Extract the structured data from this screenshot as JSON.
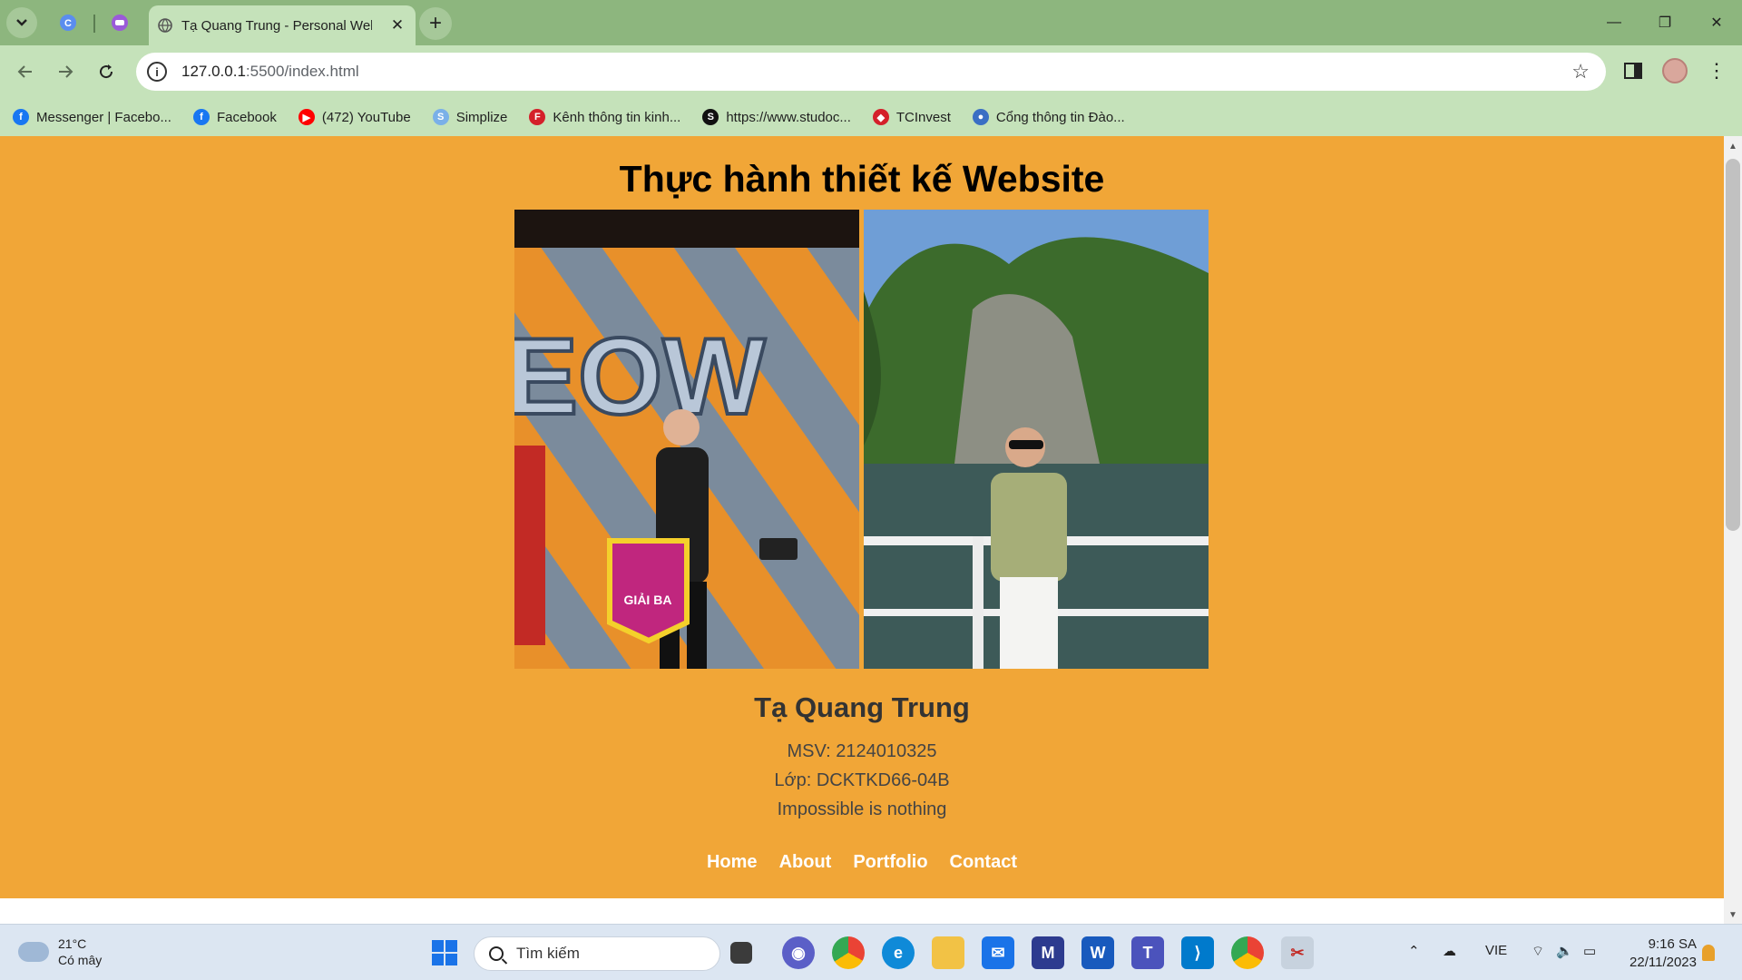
{
  "browser": {
    "tab": {
      "title": "Tạ Quang Trung - Personal Website",
      "close": "✕"
    },
    "new_tab": "+",
    "window": {
      "minimize": "—",
      "maximize": "❐",
      "close": "✕"
    },
    "address": {
      "host": "127.0.0.1",
      "rest": ":5500/index.html"
    },
    "bookmarks": [
      {
        "label": "Messenger | Facebo...",
        "icon": "facebook-icon",
        "color": "#1877f2",
        "glyph": "f"
      },
      {
        "label": "Facebook",
        "icon": "facebook-icon",
        "color": "#1877f2",
        "glyph": "f"
      },
      {
        "label": "(472) YouTube",
        "icon": "youtube-icon",
        "color": "#ff0000",
        "glyph": "▶"
      },
      {
        "label": "Simplize",
        "icon": "simplize-icon",
        "color": "#7ab0e8",
        "glyph": "S"
      },
      {
        "label": "Kênh thông tin kinh...",
        "icon": "news-icon",
        "color": "#d4202a",
        "glyph": "F"
      },
      {
        "label": "https://www.studoc...",
        "icon": "studocu-icon",
        "color": "#111111",
        "glyph": "S"
      },
      {
        "label": "TCInvest",
        "icon": "tcinvest-icon",
        "color": "#d4202a",
        "glyph": "◆"
      },
      {
        "label": "Cổng thông tin Đào...",
        "icon": "portal-icon",
        "color": "#3a6fc4",
        "glyph": "●"
      }
    ]
  },
  "page": {
    "heading": "Thực hành thiết kế Website",
    "name": "Tạ Quang Trung",
    "msv": "MSV: 2124010325",
    "class": "Lớp: DCKTKD66-04B",
    "motto": "Impossible is nothing",
    "nav": [
      "Home",
      "About",
      "Portfolio",
      "Contact"
    ],
    "background": "#f1a637"
  },
  "taskbar": {
    "weather": {
      "temp": "21°C",
      "desc": "Có mây"
    },
    "search_placeholder": "Tìm kiếm",
    "language": "VIE",
    "time": "9:16 SA",
    "date": "22/11/2023"
  }
}
